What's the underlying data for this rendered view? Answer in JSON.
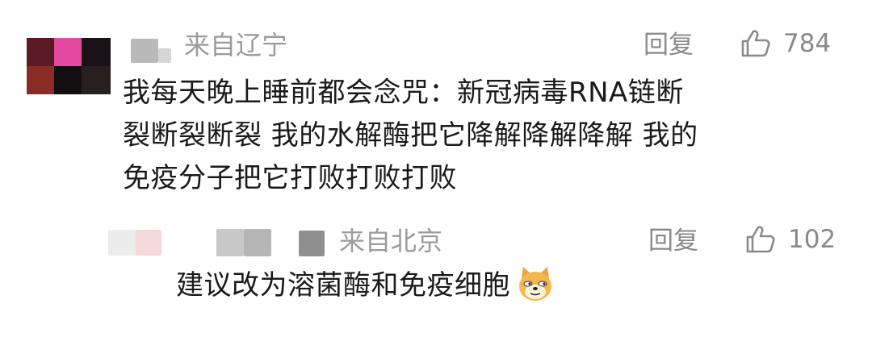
{
  "comment": {
    "location": "来自辽宁",
    "reply_label": "回复",
    "like_count": "784",
    "text_lines": [
      "我每天晚上睡前都会念咒：新冠病毒RNA链断",
      "裂断裂断裂 我的水解酶把它降解降解降解 我的",
      "免疫分子把它打败打败打败"
    ]
  },
  "reply": {
    "location": "来自北京",
    "reply_label": "回复",
    "like_count": "102",
    "text": "建议改为溶菌酶和免疫细胞"
  },
  "icons": {
    "like": "thumbs-up-icon",
    "emoji": "doge-emoji"
  },
  "colors": {
    "text": "#1a1a1a",
    "muted": "#9b9b9b",
    "action": "#8a8a8a"
  }
}
